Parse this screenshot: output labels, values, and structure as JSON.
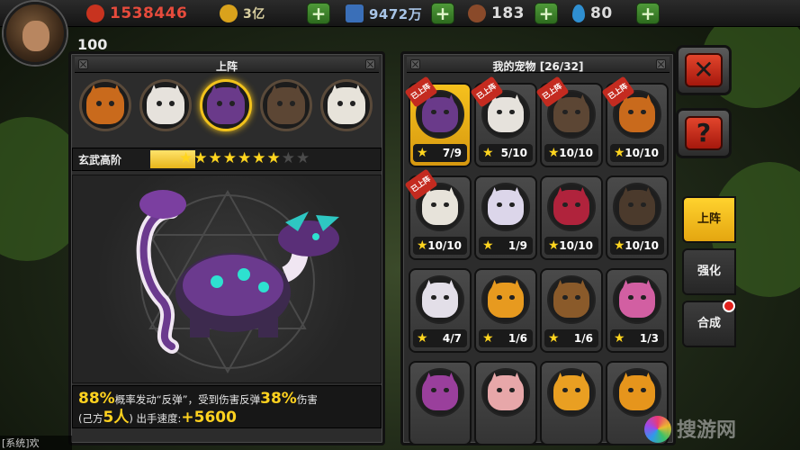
{
  "resources": {
    "gold": "1538446",
    "coins": "3亿",
    "gems": "9472万",
    "meat": "183",
    "water": "80"
  },
  "player": {
    "level": "100"
  },
  "team_panel": {
    "title": "上阵",
    "slots": [
      {
        "name": "fox",
        "color": "#c96a1c"
      },
      {
        "name": "white-wolf",
        "color": "#e6e2dc"
      },
      {
        "name": "purple-dragon",
        "color": "#6a3a8a",
        "selected": true
      },
      {
        "name": "gorilla",
        "color": "#5c4634"
      },
      {
        "name": "white-tiger",
        "color": "#e7e3da"
      }
    ],
    "rank_name": "玄武高阶",
    "stars_total": 9,
    "stars_filled": 7,
    "skill_text": {
      "pct1": "88%",
      "line1a": "概率发动“反弹”，受到伤害反弹",
      "pct2": "38%",
      "line1b": "伤害",
      "line2a": "(己方",
      "count": "5人",
      "line2b": ") 出手速度:",
      "speed": "+5600"
    }
  },
  "pets_panel": {
    "title": "我的宠物 [26/32]",
    "badge_label": "已上阵",
    "pets": [
      {
        "name": "purple-dragon",
        "count": "7/9",
        "color": "#6a3a8a",
        "badge": true,
        "selected": true
      },
      {
        "name": "white-wolf",
        "count": "5/10",
        "color": "#e6e2dc",
        "badge": true
      },
      {
        "name": "gorilla",
        "count": "10/10",
        "color": "#5c4634",
        "badge": true
      },
      {
        "name": "fox",
        "count": "10/10",
        "color": "#c96a1c",
        "badge": true
      },
      {
        "name": "white-tiger",
        "count": "10/10",
        "color": "#e7e3da",
        "badge": true
      },
      {
        "name": "white-wolf-purple",
        "count": "1/9",
        "color": "#dcd6ea"
      },
      {
        "name": "red-dragon",
        "count": "10/10",
        "color": "#b0233c"
      },
      {
        "name": "gorilla-dark",
        "count": "10/10",
        "color": "#4b3a2c"
      },
      {
        "name": "white-tiger-2",
        "count": "4/7",
        "color": "#e3dfe8"
      },
      {
        "name": "gold-dragon",
        "count": "1/6",
        "color": "#e79a1f"
      },
      {
        "name": "monkey",
        "count": "1/6",
        "color": "#8a5a2a"
      },
      {
        "name": "pink-dino",
        "count": "1/3",
        "color": "#d25fa2"
      },
      {
        "name": "purple-dino",
        "count": "",
        "color": "#9a3f9c"
      },
      {
        "name": "pink-hamster",
        "count": "",
        "color": "#e7a7a9"
      },
      {
        "name": "gold-dragon-2",
        "count": "",
        "color": "#e99f22"
      },
      {
        "name": "gold-dragon-3",
        "count": "",
        "color": "#e6951c"
      }
    ]
  },
  "side": {
    "close_label": "✕",
    "help_label": "?",
    "tabs": [
      "上阵",
      "强化",
      "合成"
    ],
    "active_tab": 0
  },
  "chat": {
    "text": "[系统]欢"
  },
  "watermark": "搜游网"
}
